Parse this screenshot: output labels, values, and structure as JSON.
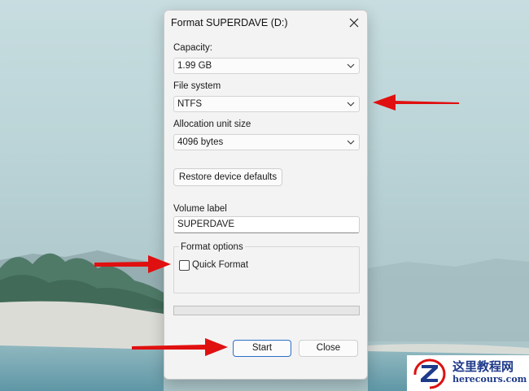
{
  "dialog": {
    "title": "Format SUPERDAVE (D:)",
    "capacity_label": "Capacity:",
    "capacity_value": "1.99 GB",
    "filesystem_label": "File system",
    "filesystem_value": "NTFS",
    "allocation_label": "Allocation unit size",
    "allocation_value": "4096 bytes",
    "restore_button": "Restore device defaults",
    "volume_label": "Volume label",
    "volume_value": "SUPERDAVE",
    "format_options_label": "Format options",
    "quick_format_label": "Quick Format",
    "quick_format_checked": false,
    "progress": 0,
    "start_button": "Start",
    "close_button": "Close"
  },
  "annotations": {
    "arrow_color": "#e01010"
  },
  "watermark": {
    "line1": "这里教程网",
    "line2": "herecours.com"
  },
  "colors": {
    "accent": "#2a6fc9",
    "dialog_bg": "#f3f3f3"
  }
}
